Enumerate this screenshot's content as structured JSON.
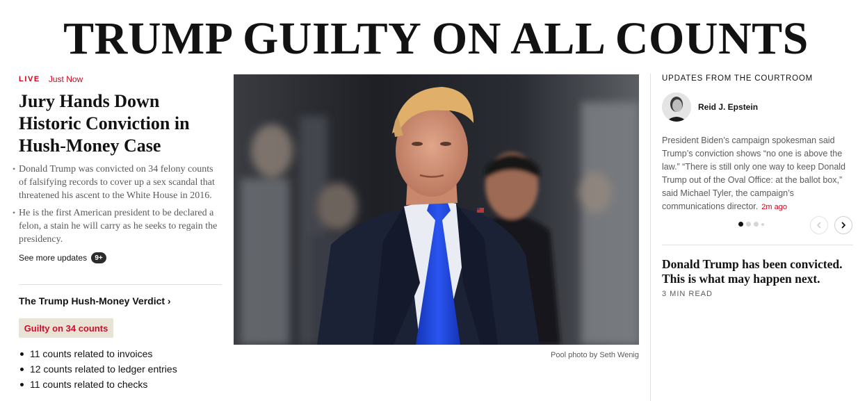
{
  "headline": "TRUMP GUILTY ON ALL COUNTS",
  "main_story": {
    "live_label": "LIVE",
    "timestamp": "Just Now",
    "title": "Jury Hands Down Historic Conviction in Hush-Money Case",
    "summary": [
      "Donald Trump was convicted on 34 felony counts of falsifying records to cover up a sex scandal that threatened his ascent to the White House in 2016.",
      "He is the first American president to be declared a felon, a stain he will carry as he seeks to regain the presidency."
    ],
    "see_more_label": "See more updates",
    "see_more_badge": "9+"
  },
  "verdict": {
    "link_label": "The Trump Hush-Money Verdict ›",
    "pill": "Guilty on 34 counts",
    "counts": [
      "11 counts related to invoices",
      "12 counts related to ledger entries",
      "11 counts related to checks"
    ]
  },
  "photo": {
    "credit": "Pool photo by Seth Wenig"
  },
  "updates": {
    "kicker": "UPDATES FROM THE COURTROOM",
    "author": "Reid J. Epstein",
    "text": "President Biden’s campaign spokesman said Trump’s conviction shows “no one is above the law.” “There is still only one way to keep Donald Trump out of the Oval Office: at the ballot box,” said Michael Tyler, the campaign’s communications director.",
    "time": "2m ago",
    "carousel_active_index": 0,
    "carousel_count": 4
  },
  "secondary_story": {
    "title": "Donald Trump has been convicted. This is what may happen next.",
    "read_time": "3 MIN READ"
  },
  "colors": {
    "live_red": "#d0021b",
    "pill_bg": "#e8e3d4",
    "pill_text": "#c8102e",
    "tie_blue": "#1f45d6"
  },
  "icons": {
    "prev": "chevron-left-icon",
    "next": "chevron-right-icon"
  }
}
